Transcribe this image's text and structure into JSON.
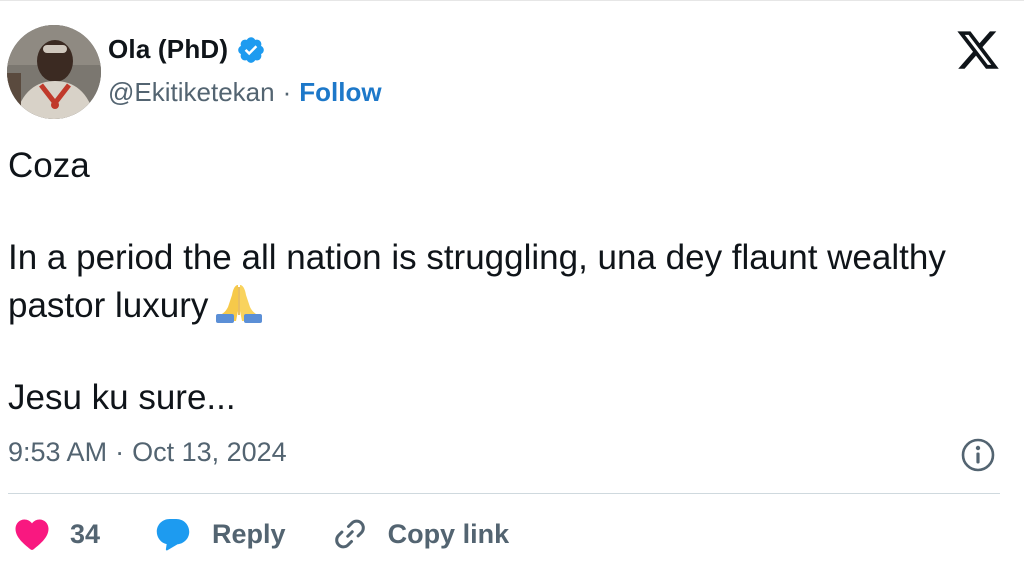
{
  "author": {
    "display_name": "Ola (PhD)",
    "handle": "@Ekitiketekan",
    "verified": true,
    "follow_label": "Follow",
    "separator": "·"
  },
  "tweet": {
    "paragraphs": [
      "Coza",
      "In a period the all nation is struggling, una dey flaunt wealthy pastor luxury",
      "Jesu ku sure..."
    ],
    "emoji": "folded-hands-emoji"
  },
  "meta": {
    "time": "9:53 AM",
    "separator": "·",
    "date": "Oct 13, 2024"
  },
  "actions": {
    "like_count": "34",
    "reply_label": "Reply",
    "copy_link_label": "Copy link"
  },
  "colors": {
    "verified": "#1d9bf0",
    "follow": "#1d78c9",
    "like": "#f91880",
    "reply": "#1d9bf0",
    "muted": "#536471",
    "text": "#0f1419"
  },
  "icons": {
    "brand": "x-logo-icon",
    "verified": "verified-badge-icon",
    "info": "info-icon",
    "like": "heart-icon",
    "reply": "speech-bubble-icon",
    "copy": "link-icon"
  }
}
